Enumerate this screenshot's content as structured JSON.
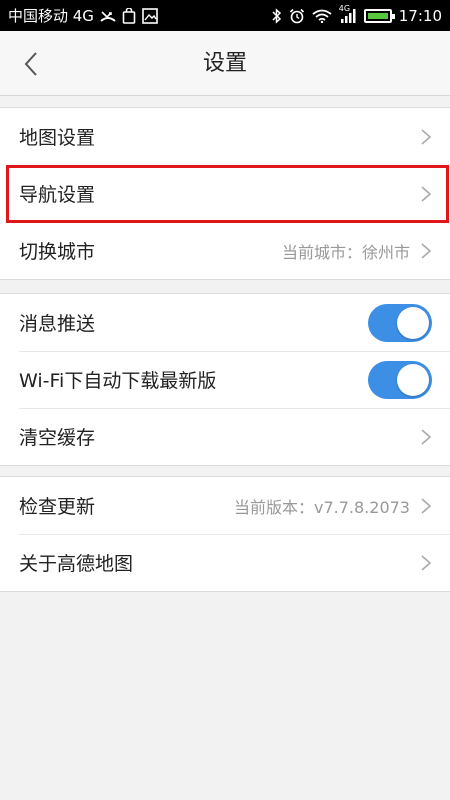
{
  "status_bar": {
    "carrier": "中国移动 4G",
    "net_label": "4G",
    "time": "17:10"
  },
  "nav": {
    "title": "设置"
  },
  "groups": [
    {
      "rows": [
        {
          "label": "地图设置",
          "value": ""
        },
        {
          "label": "导航设置",
          "value": ""
        },
        {
          "label": "切换城市",
          "value": "当前城市：徐州市"
        }
      ]
    },
    {
      "rows": [
        {
          "label": "消息推送",
          "toggle": true
        },
        {
          "label": "Wi-Fi下自动下载最新版",
          "toggle": true
        },
        {
          "label": "清空缓存",
          "value": ""
        }
      ]
    },
    {
      "rows": [
        {
          "label": "检查更新",
          "value": "当前版本：v7.7.8.2073"
        },
        {
          "label": "关于高德地图",
          "value": ""
        }
      ]
    }
  ],
  "colors": {
    "toggle_on": "#3d8fe6",
    "highlight": "#e0161b"
  },
  "icons": [
    "back-arrow-icon",
    "chevron-right-icon",
    "bluetooth-icon",
    "alarm-icon",
    "wifi-icon",
    "signal-icon",
    "battery-icon"
  ]
}
